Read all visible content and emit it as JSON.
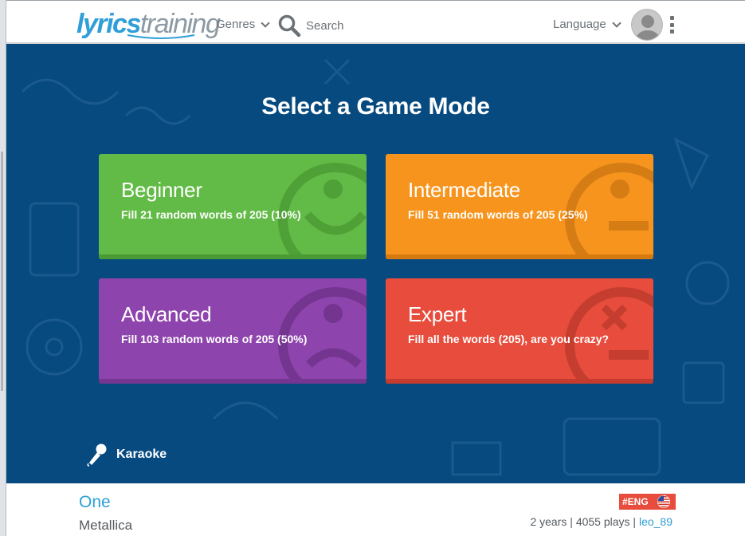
{
  "header": {
    "logo_part1": "lyrics",
    "logo_part2": "training",
    "genres_label": "Genres",
    "search_label": "Search",
    "language_label": "Language"
  },
  "main": {
    "title": "Select a Game Mode",
    "modes": [
      {
        "name": "Beginner",
        "description": "Fill 21 random words of 205 (10%)",
        "color": "#62bb46"
      },
      {
        "name": "Intermediate",
        "description": "Fill 51 random words of 205 (25%)",
        "color": "#f7941d"
      },
      {
        "name": "Advanced",
        "description": "Fill 103 random words of 205 (50%)",
        "color": "#8e44ad"
      },
      {
        "name": "Expert",
        "description": "Fill all the words (205), are you crazy?",
        "color": "#e74c3c"
      }
    ],
    "karaoke_label": "Karaoke",
    "background_color": "#074a80"
  },
  "footer": {
    "song_title": "One",
    "artist": "Metallica",
    "language_tag": "#ENG",
    "age": "2 years",
    "separator": " | ",
    "plays": "4055 plays",
    "user": "leo_89"
  },
  "icons": [
    "search-icon",
    "chevron-down-icon",
    "avatar-icon",
    "more-vert-icon",
    "smiley-face-icon",
    "neutral-face-icon",
    "sad-face-icon",
    "dead-face-icon",
    "microphone-icon",
    "us-flag-icon"
  ]
}
